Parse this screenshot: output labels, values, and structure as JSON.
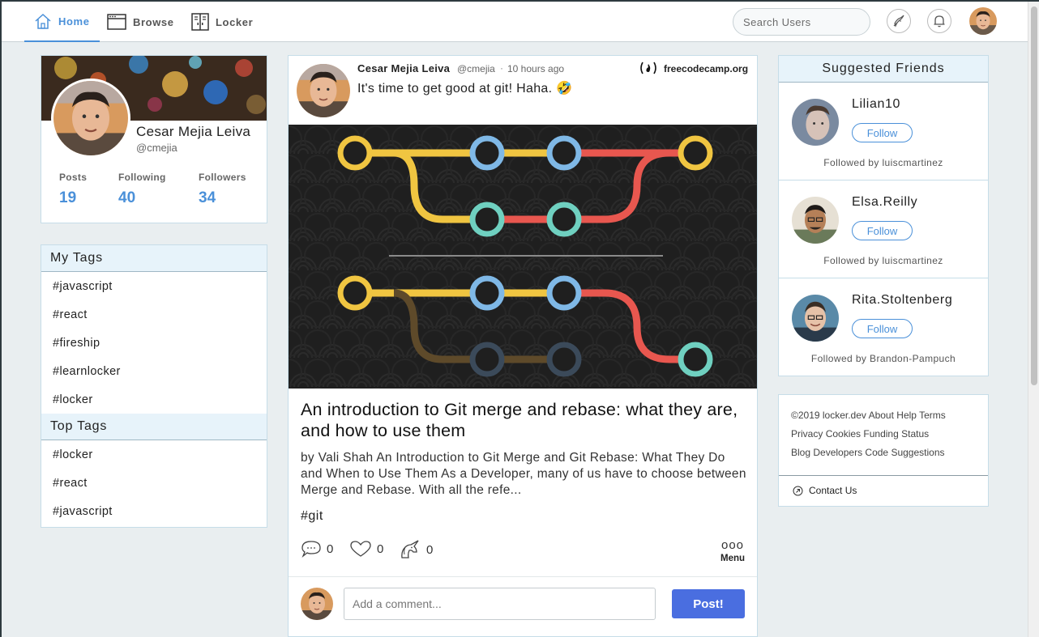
{
  "nav": {
    "items": [
      {
        "label": "Home",
        "icon": "home-icon"
      },
      {
        "label": "Browse",
        "icon": "browser-window-icon"
      },
      {
        "label": "Locker",
        "icon": "locker-icon"
      }
    ],
    "search_placeholder": "Search Users",
    "colors": {
      "active": "#4a90d9"
    }
  },
  "profile": {
    "name": "Cesar Mejia Leiva",
    "handle": "@cmejia",
    "stats": [
      {
        "label": "Posts",
        "value": "19"
      },
      {
        "label": "Following",
        "value": "40"
      },
      {
        "label": "Followers",
        "value": "34"
      }
    ]
  },
  "my_tags": {
    "title": "My Tags",
    "items": [
      "#javascript",
      "#react",
      "#fireship",
      "#learnlocker",
      "#locker"
    ]
  },
  "top_tags": {
    "title": "Top Tags",
    "items": [
      "#locker",
      "#react",
      "#javascript"
    ]
  },
  "post": {
    "author": "Cesar Mejia Leiva",
    "handle": "@cmejia",
    "separator": "·",
    "time": "10 hours ago",
    "source": "freecodecamp.org",
    "text": "It's time to get good at git! Haha. 🤣",
    "article_title": "An introduction to Git merge and rebase: what they are, and how to use them",
    "article_description": "by Vali Shah An Introduction to Git Merge and Git Rebase: What They Do and When to Use Them As a Developer, many of us have to choose between Merge and Rebase. With all the refe...",
    "tag": "#git",
    "actions": {
      "comments": "0",
      "likes": "0",
      "unicorns": "0"
    },
    "menu_dots": "ooo",
    "menu_label": "Menu",
    "comment_placeholder": "Add a comment...",
    "post_button": "Post!"
  },
  "suggested": {
    "title": "Suggested Friends",
    "follow_label": "Follow",
    "friends": [
      {
        "name": "Lilian10",
        "followed_by": "Followed by luiscmartinez"
      },
      {
        "name": "Elsa.Reilly",
        "followed_by": "Followed by luiscmartinez"
      },
      {
        "name": "Rita.Stoltenberg",
        "followed_by": "Followed by Brandon-Pampuch"
      }
    ]
  },
  "footer": {
    "lines": [
      [
        "©2019 locker.dev",
        "About",
        "Help",
        "Terms"
      ],
      [
        "Privacy",
        "Cookies",
        "Funding",
        "Status"
      ],
      [
        "Blog",
        "Developers",
        "Code",
        "Suggestions"
      ]
    ],
    "contact": "Contact Us"
  }
}
